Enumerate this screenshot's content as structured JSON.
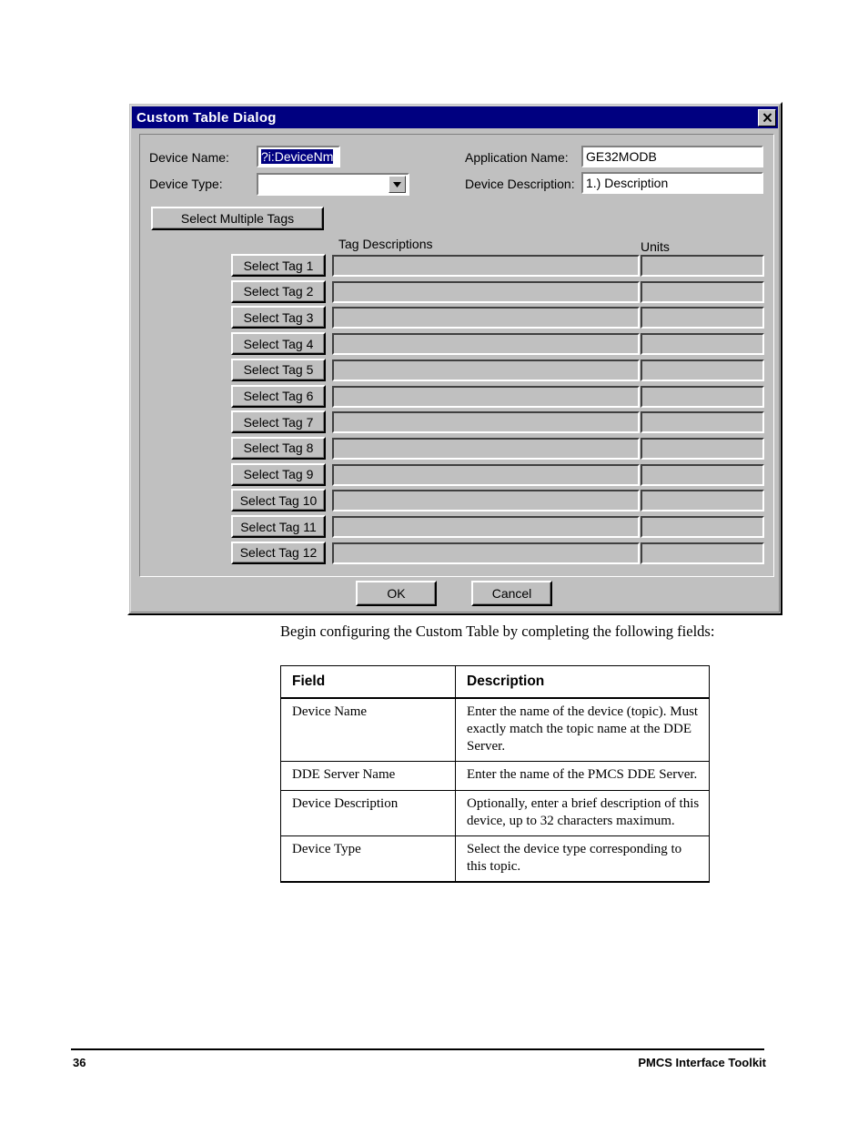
{
  "dialog": {
    "title": "Custom Table Dialog",
    "close_label": "×",
    "fields": {
      "device_name_label": "Device Name:",
      "device_name_value": "?i:DeviceNm",
      "device_type_label": "Device Type:",
      "device_type_value": "",
      "application_name_label": "Application Name:",
      "application_name_value": "GE32MODB",
      "device_description_label": "Device Description:",
      "device_description_value": "1.) Description"
    },
    "select_multiple_tags_label": "Select Multiple Tags",
    "columns": {
      "tag_descriptions": "Tag Descriptions",
      "units": "Units"
    },
    "tag_rows": [
      {
        "button_label": "Select Tag 1",
        "description": "",
        "units": ""
      },
      {
        "button_label": "Select Tag 2",
        "description": "",
        "units": ""
      },
      {
        "button_label": "Select Tag 3",
        "description": "",
        "units": ""
      },
      {
        "button_label": "Select Tag 4",
        "description": "",
        "units": ""
      },
      {
        "button_label": "Select Tag 5",
        "description": "",
        "units": ""
      },
      {
        "button_label": "Select Tag 6",
        "description": "",
        "units": ""
      },
      {
        "button_label": "Select Tag 7",
        "description": "",
        "units": ""
      },
      {
        "button_label": "Select Tag 8",
        "description": "",
        "units": ""
      },
      {
        "button_label": "Select Tag 9",
        "description": "",
        "units": ""
      },
      {
        "button_label": "Select Tag 10",
        "description": "",
        "units": ""
      },
      {
        "button_label": "Select Tag 11",
        "description": "",
        "units": ""
      },
      {
        "button_label": "Select Tag 12",
        "description": "",
        "units": ""
      }
    ],
    "ok_label": "OK",
    "cancel_label": "Cancel",
    "colors": {
      "titlebar": "#000080",
      "face": "#c0c0c0",
      "selection": "#000080"
    }
  },
  "document": {
    "intro_paragraph": "Begin configuring the Custom Table by completing the following fields:",
    "table": {
      "headers": [
        "Field",
        "Description"
      ],
      "rows": [
        {
          "field": "Device Name",
          "description": "Enter the name of the device (topic). Must exactly match the topic name at the DDE Server."
        },
        {
          "field": "DDE Server Name",
          "description": "Enter the name of the PMCS DDE Server."
        },
        {
          "field": "Device Description",
          "description": "Optionally, enter a brief description of this device, up to 32 characters maximum."
        },
        {
          "field": "Device Type",
          "description": "Select the device type corresponding to this topic."
        }
      ]
    }
  },
  "footer": {
    "page_number": "36",
    "document_title": "PMCS Interface Toolkit"
  }
}
